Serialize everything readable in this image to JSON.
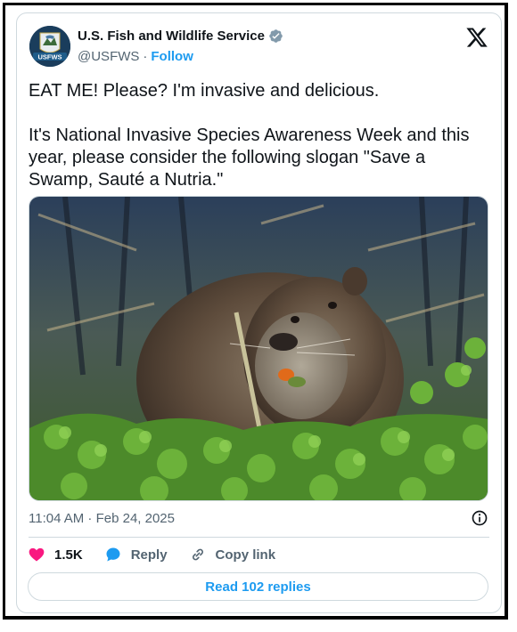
{
  "account": {
    "name": "U.S. Fish and Wildlife Service",
    "handle": "@USFWS",
    "separator": "·",
    "follow_label": "Follow",
    "avatar_text": "USFWS",
    "verified_icon": "verified-badge-icon",
    "verified_color": "#829aab"
  },
  "tweet": {
    "text": "EAT ME! Please? I'm invasive and delicious.\n\nIt's National Invasive Species Awareness Week and this year, please consider the following slogan \"Save a Swamp, Sauté a Nutria.\"",
    "timestamp": "11:04 AM · Feb 24, 2025"
  },
  "actions": {
    "likes": "1.5K",
    "reply_label": "Reply",
    "copy_label": "Copy link",
    "read_replies": "Read 102 replies"
  },
  "colors": {
    "like": "#f91880",
    "reply": "#1d9bf0",
    "link": "#1d9bf0",
    "muted": "#536471"
  }
}
